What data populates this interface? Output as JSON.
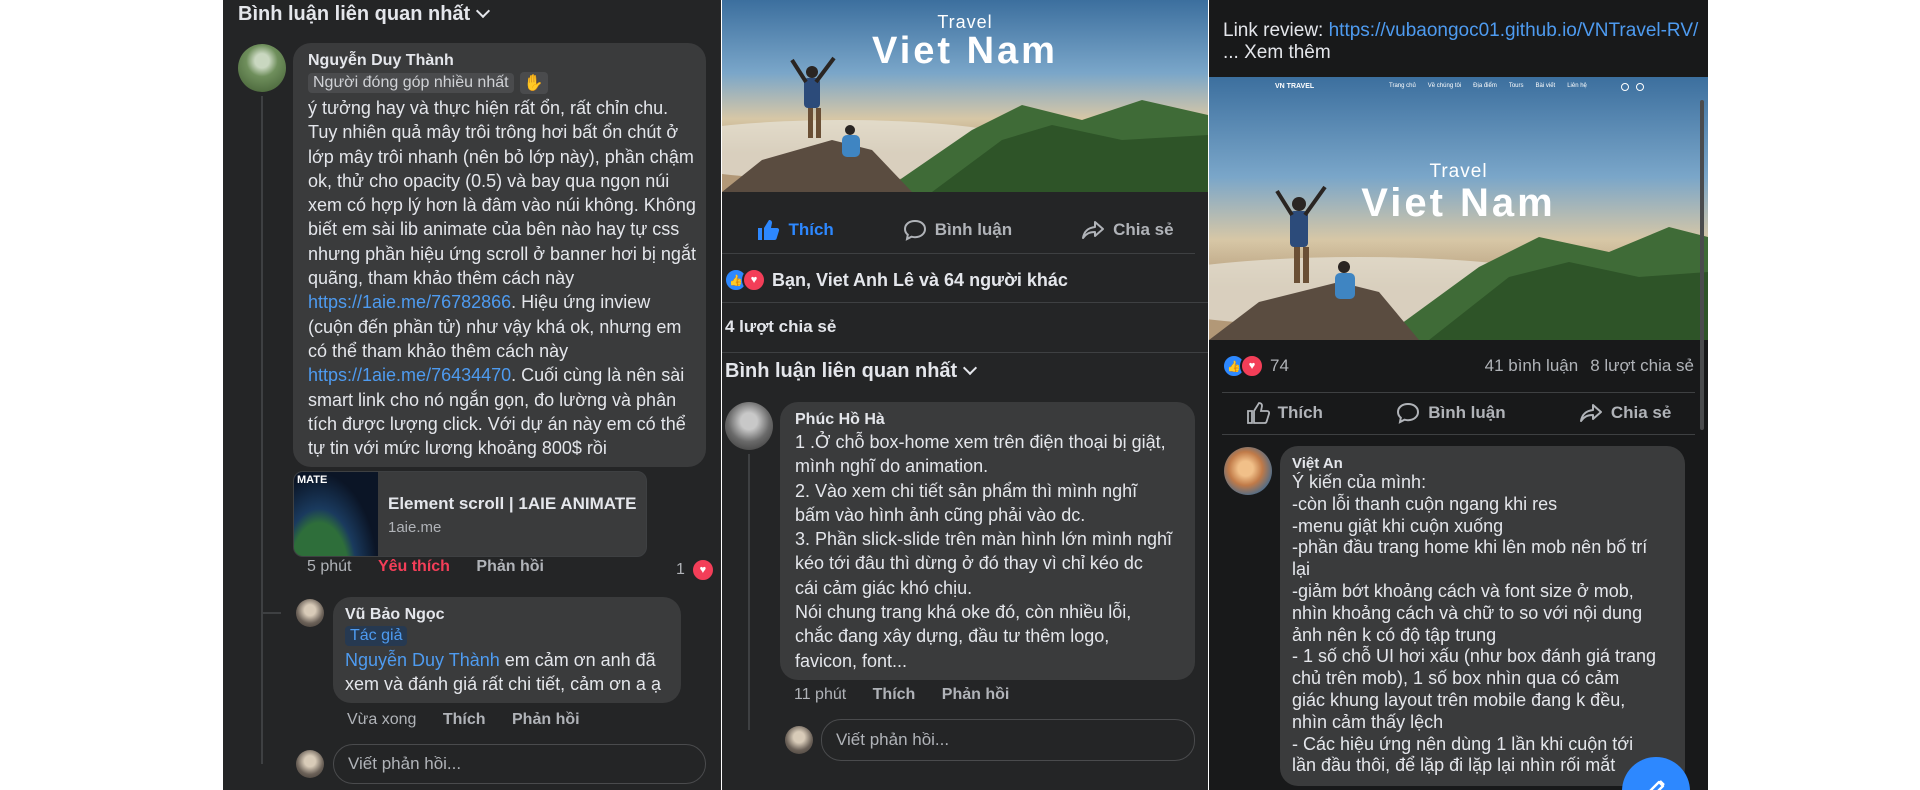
{
  "left_panel": {
    "sort_label": "Bình luận liên quan nhất",
    "comment": {
      "author": "Nguyễn Duy Thành",
      "badge": "Người đóng góp nhiều nhất",
      "text_1": "ý tưởng hay và thực hiện rất ổn, rất chỉn chu. Tuy nhiên quả mây trôi trông hơi bất ổn chút ở lớp mây trôi nhanh (nên bỏ lớp này), phần chậm ok, thử cho opacity (0.5) và bay qua ngọn núi xem có hợp lý hơn là đâm vào núi không. Không biết em sài lib animate của bên nào hay tự css nhưng phần hiệu ứng scroll ở banner hơi bị ngắt quãng, tham khảo thêm cách này ",
      "link_1": "https://1aie.me/76782866",
      "text_2": ". Hiệu ứng inview (cuộn đến phần tử) như vậy khá ok, nhưng em có thể tham khảo thêm cách này ",
      "link_2": "https://1aie.me/76434470",
      "text_3": ". Cuối cùng là nên sài smart link cho nó ngắn gọn, đo lường và phân tích được lượng click. Với dự án này em có thể tự tin với mức lương khoảng 800$ rồi",
      "preview_title": "Element scroll | 1AIE ANIMATE",
      "preview_domain": "1aie.me",
      "preview_thumb_text": "MATE",
      "time": "5 phút",
      "liked_label": "Yêu thích",
      "reply_label": "Phản hồi",
      "reaction_count": "1"
    },
    "reply": {
      "author": "Vũ Bảo Ngọc",
      "badge": "Tác giả",
      "mention": "Nguyễn Duy Thành",
      "text": " em cảm ơn anh đã xem và đánh giá rất chi tiết, cảm ơn a ạ",
      "time": "Vừa xong",
      "like_label": "Thích",
      "reply_label": "Phản hồi"
    },
    "reply_placeholder": "Viết phản hồi..."
  },
  "middle_panel": {
    "hero_small": "Travel",
    "hero_big": "Viet Nam",
    "like_label": "Thích",
    "comment_label": "Bình luận",
    "share_label": "Chia sẻ",
    "reactions_text": "Bạn, Viet Anh Lê và 64 người khác",
    "shares_text": "4 lượt chia sẻ",
    "sort_label": "Bình luận liên quan nhất",
    "comment": {
      "author": "Phúc Hồ Hà",
      "lines": [
        "1 .Ở chỗ box-home xem trên điện thoại bị giật,",
        "mình nghĩ do animation.",
        "2. Vào xem chi tiết sản phẩm thì mình nghĩ",
        "bấm vào hình ảnh cũng phải vào dc.",
        "3. Phần slick-slide trên màn hình lớn mình nghĩ",
        "kéo tới đâu thì dừng ở đó thay vì chỉ kéo dc",
        "cái cảm giác khó chịu.",
        "Nói chung trang khá oke đó, còn nhiều lỗi,",
        "chắc đang xây dựng, đầu tư thêm logo,",
        "favicon, font..."
      ],
      "time": "11 phút",
      "like_label": "Thích",
      "reply_label": "Phản hồi"
    },
    "reply_placeholder": "Viết phản hồi..."
  },
  "right_panel": {
    "link_prefix": "Link review: ",
    "link_url": "https://vubaongoc01.github.io/VNTravel-RV/",
    "see_more": "... Xem thêm",
    "site_logo": "VN TRAVEL",
    "site_nav": [
      "Trang chủ",
      "Về chúng tôi",
      "Địa điểm",
      "Tours",
      "Bài viết",
      "Liên hệ"
    ],
    "hero_small": "Travel",
    "hero_big": "Viet Nam",
    "reaction_count": "74",
    "comments_count": "41 bình luận",
    "shares_count": "8 lượt chia sẻ",
    "like_label": "Thích",
    "comment_label": "Bình luận",
    "share_label": "Chia sẻ",
    "comment": {
      "author": "Việt An",
      "lines": [
        "Ý kiến của mình:",
        "-còn lỗi thanh cuộn ngang khi res",
        "-menu giật khi cuộn xuống",
        "-phần đầu trang home khi lên mob nên bố trí",
        "lại",
        "-giảm bớt khoảng cách và font size ở mob,",
        "nhìn khoảng cách và chữ to so với nội dung",
        "ảnh nên k có độ tập trung",
        "- 1 số chỗ UI hơi xấu (như box đánh giá trang",
        "chủ trên mob), 1 số box nhìn qua có cảm",
        "giác khung layout trên mobile đang k đều,",
        "nhìn cảm thấy lệch",
        "- Các hiệu ứng nên dùng 1 lần khi cuộn tới",
        "lần đầu thôi, để lặp đi lặp lại nhìn rối mắt"
      ]
    }
  },
  "colors": {
    "panel_bg": "#242526",
    "bubble_bg": "#3a3b3c",
    "link_blue": "#4e9bf0",
    "like_blue": "#2d88ff",
    "love_red": "#f33e58",
    "text_primary": "#e4e6eb",
    "text_secondary": "#b0b3b8"
  }
}
